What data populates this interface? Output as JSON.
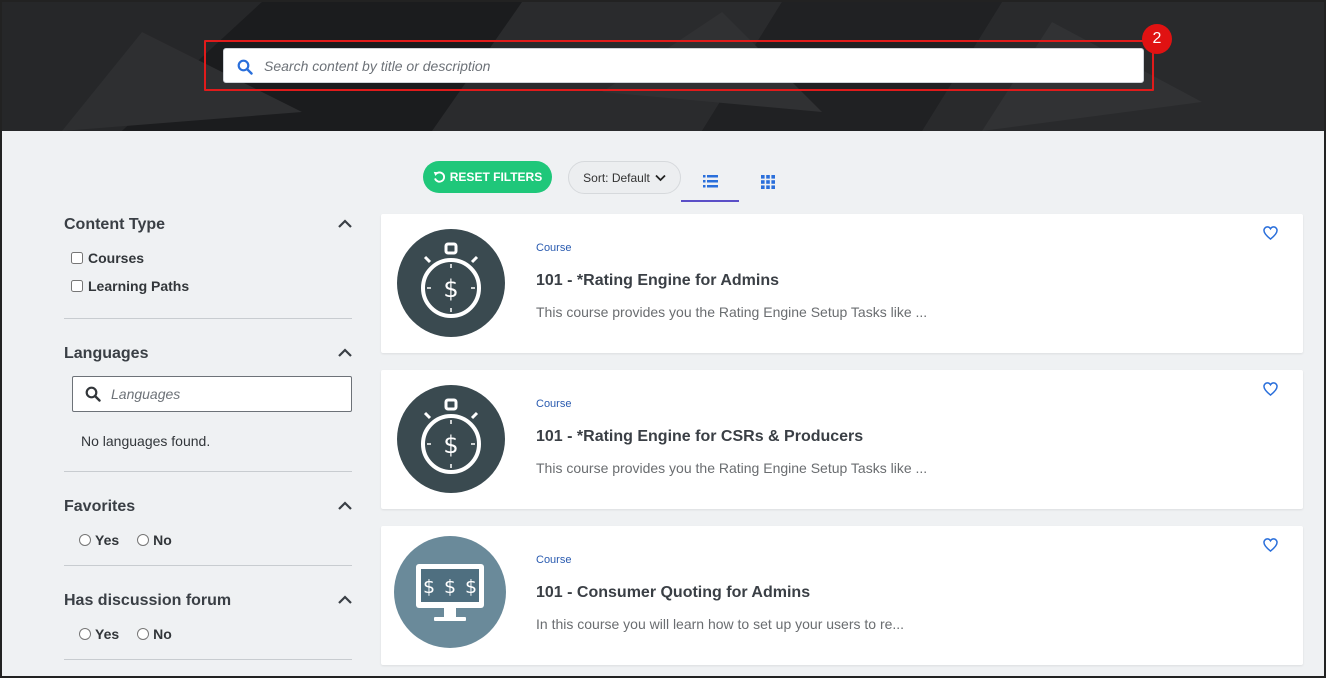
{
  "search": {
    "placeholder": "Search content by title or description"
  },
  "step_badge": "2",
  "toolbar": {
    "reset_label": "RESET FILTERS",
    "sort_label": "Sort: Default"
  },
  "filters": {
    "content_type": {
      "title": "Content Type",
      "options": [
        "Courses",
        "Learning Paths"
      ]
    },
    "languages": {
      "title": "Languages",
      "placeholder": "Languages",
      "empty_text": "No languages found."
    },
    "favorites": {
      "title": "Favorites",
      "options": [
        "Yes",
        "No"
      ]
    },
    "discussion": {
      "title": "Has discussion forum",
      "options": [
        "Yes",
        "No"
      ]
    }
  },
  "cards": [
    {
      "type": "Course",
      "title": "101 - *Rating Engine for Admins",
      "description": "This course provides you the Rating Engine Setup Tasks like ...",
      "thumb_icon": "stopwatch-dollar-icon"
    },
    {
      "type": "Course",
      "title": "101 - *Rating Engine for CSRs & Producers",
      "description": "This course provides you the Rating Engine Setup Tasks like ...",
      "thumb_icon": "stopwatch-dollar-icon"
    },
    {
      "type": "Course",
      "title": "101 - Consumer Quoting for Admins",
      "description": "In this course you will learn how to set up your users to re...",
      "thumb_icon": "monitor-dollar-icon",
      "thumb_symbols": [
        "$",
        "$",
        "$"
      ]
    }
  ],
  "colors": {
    "accent_green": "#1fc77a",
    "link_blue": "#2a5bb0",
    "highlight_red": "#e01b1b",
    "tab_underline": "#5b4fc7"
  }
}
